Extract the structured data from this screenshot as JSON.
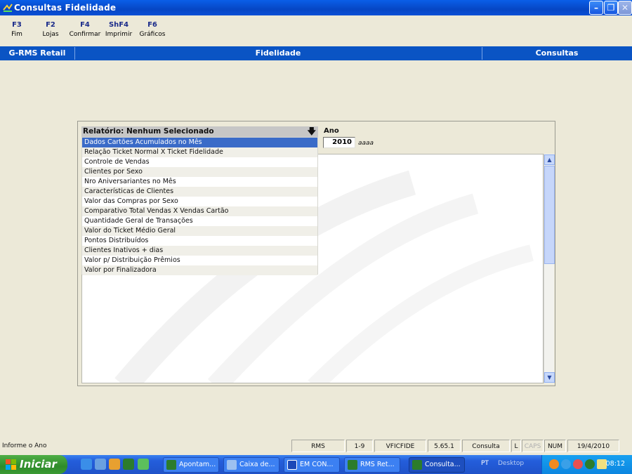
{
  "window": {
    "title": "Consultas Fidelidade"
  },
  "toolbar": {
    "keys": [
      {
        "key": "F3",
        "label": "Fim"
      },
      {
        "key": "F2",
        "label": "Lojas"
      },
      {
        "key": "F4",
        "label": "Confirmar"
      },
      {
        "key": "ShF4",
        "label": "Imprimir"
      },
      {
        "key": "F6",
        "label": "Gráficos"
      }
    ]
  },
  "band": {
    "left": "G-RMS Retail",
    "center": "Fidelidade",
    "right": "Consultas"
  },
  "report": {
    "header": "Relatório: Nenhum Selecionado",
    "items": [
      "Dados Cartões Acumulados no Mês",
      "Relação Ticket Normal X Ticket Fidelidade",
      "Controle de Vendas",
      "Clientes por Sexo",
      "Nro Aniversariantes no Mês",
      "Características de Clientes",
      "Valor das Compras por Sexo",
      "Comparativo Total Vendas X Vendas Cartão",
      "Quantidade Geral de Transações",
      "Valor do Ticket Médio Geral",
      "Pontos Distribuídos",
      "Clientes Inativos +  dias",
      "Valor p/ Distribuição Prêmios",
      "Valor por Finalizadora"
    ],
    "selected_index": 0
  },
  "ano": {
    "label": "Ano",
    "value": "2010",
    "hint": "aaaa"
  },
  "status": {
    "message": "Informe o Ano",
    "cells": [
      "RMS",
      "1-9",
      "VFICFIDE",
      "5.65.1",
      "Consulta",
      "L",
      "CAPS",
      "NUM",
      "19/4/2010"
    ]
  },
  "taskbar": {
    "start": "Iniciar",
    "tasks": [
      "Apontam...",
      "Caixa de...",
      "EM CON...",
      "RMS Ret...",
      "Consulta..."
    ],
    "lang": "PT",
    "desktop": "Desktop",
    "clock": "08:12"
  },
  "colors": {
    "title_bar": "#0646c4",
    "band": "#0a54c4",
    "selection": "#3a6bc8",
    "start": "#2e8b2a"
  }
}
